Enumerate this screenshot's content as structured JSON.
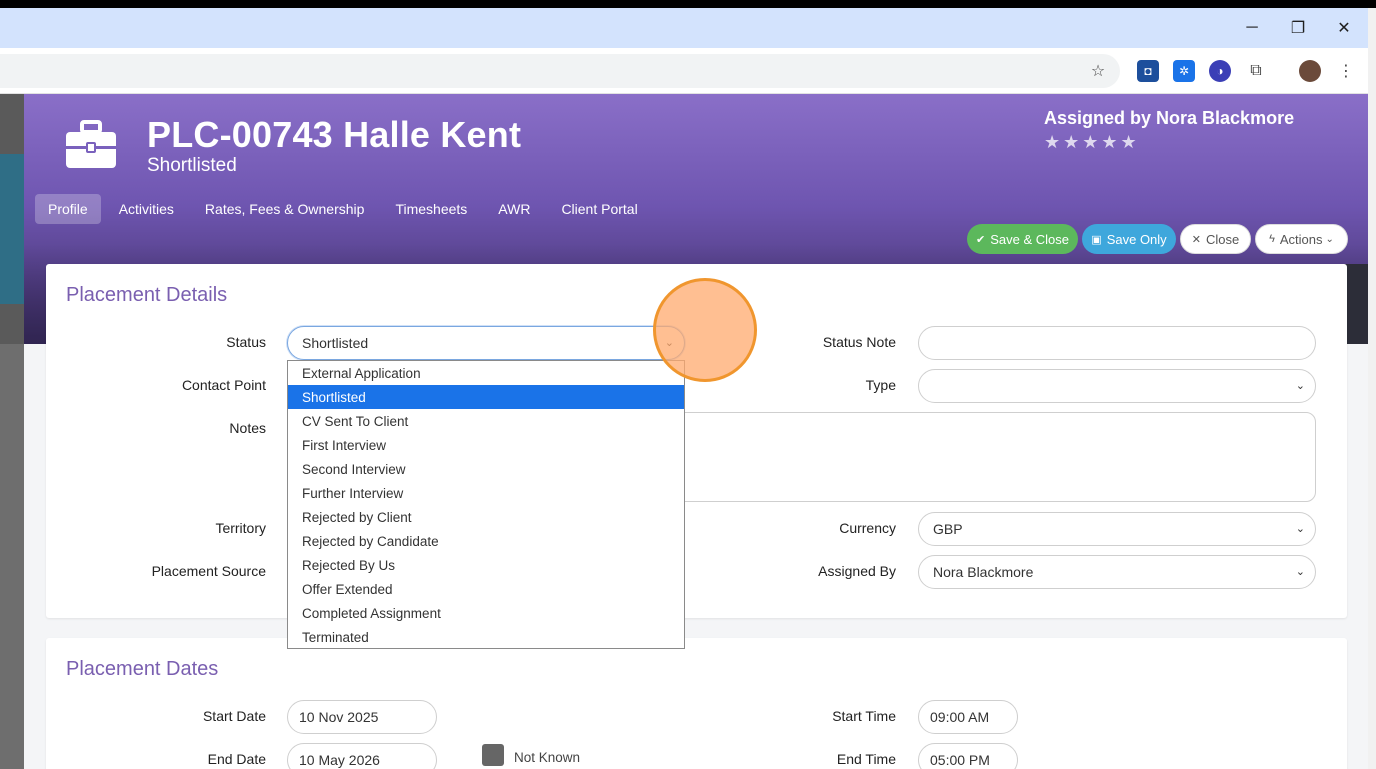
{
  "browser": {
    "window_controls": {
      "minimize": "─",
      "maximize": "❐",
      "close": "✕"
    }
  },
  "record": {
    "title": "PLC-00743 Halle Kent",
    "subtitle": "Shortlisted",
    "assigned_by": "Assigned by Nora Blackmore",
    "stars": "★★★★★"
  },
  "tabs": [
    "Profile",
    "Activities",
    "Rates, Fees & Ownership",
    "Timesheets",
    "AWR",
    "Client Portal"
  ],
  "buttons": {
    "save_close": "Save & Close",
    "save_only": "Save Only",
    "close": "Close",
    "actions": "Actions"
  },
  "placement_details": {
    "title": "Placement Details",
    "labels": {
      "status": "Status",
      "contact_point": "Contact Point",
      "notes": "Notes",
      "territory": "Territory",
      "placement_source": "Placement Source",
      "status_note": "Status Note",
      "type": "Type",
      "currency": "Currency",
      "assigned_by": "Assigned By"
    },
    "values": {
      "status": "Shortlisted",
      "status_note": "",
      "type": "",
      "currency": "GBP",
      "assigned_by": "Nora Blackmore"
    },
    "status_options": [
      "External Application",
      "Shortlisted",
      "CV Sent To Client",
      "First Interview",
      "Second Interview",
      "Further Interview",
      "Rejected by Client",
      "Rejected by Candidate",
      "Rejected By Us",
      "Offer Extended",
      "Completed Assignment",
      "Terminated"
    ],
    "selected_index": 1
  },
  "placement_dates": {
    "title": "Placement Dates",
    "labels": {
      "start_date": "Start Date",
      "end_date": "End Date",
      "not_known": "Not Known",
      "start_time": "Start Time",
      "end_time": "End Time"
    },
    "values": {
      "start_date": "10 Nov 2025",
      "end_date": "10 May 2026",
      "start_time": "09:00 AM",
      "end_time": "05:00 PM"
    }
  }
}
